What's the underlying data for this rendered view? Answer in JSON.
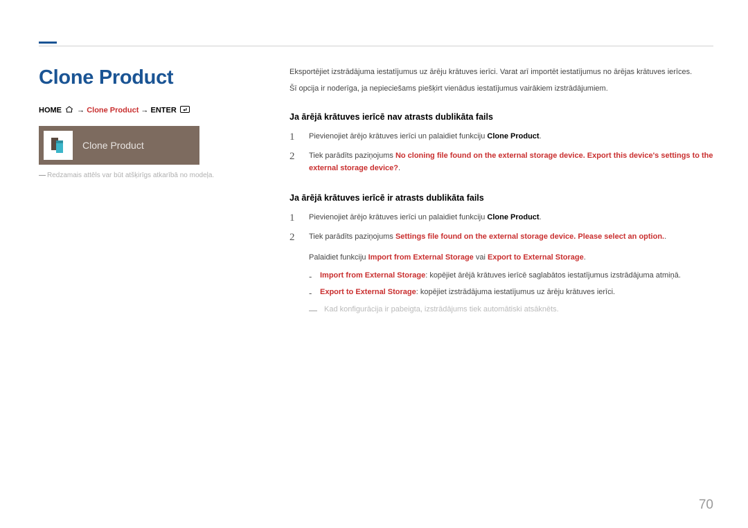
{
  "page": {
    "title": "Clone Product",
    "number": "70"
  },
  "breadcrumb": {
    "home": "HOME",
    "arrow": " → ",
    "item": "Clone Product",
    "enter": "ENTER"
  },
  "tile": {
    "label": "Clone Product"
  },
  "caption": {
    "text": "Redzamais attēls var būt atšķirīgs atkarībā no modeļa."
  },
  "intro": {
    "p1": "Eksportējiet izstrādājuma iestatījumus uz ārēju krātuves ierīci. Varat arī importēt iestatījumus no ārējas krātuves ierīces.",
    "p2": "Šī opcija ir noderīga, ja nepieciešams piešķirt vienādus iestatījumus vairākiem izstrādājumiem."
  },
  "section1": {
    "heading": "Ja ārējā krātuves ierīcē nav atrasts dublikāta fails",
    "step1_pre": "Pievienojiet ārējo krātuves ierīci un palaidiet funkciju ",
    "step1_hl": "Clone Product",
    "step1_post": ".",
    "step2_pre": "Tiek parādīts paziņojums ",
    "step2_hl": "No cloning file found on the external storage device. Export this device's settings to the external storage device?",
    "step2_post": "."
  },
  "section2": {
    "heading": "Ja ārējā krātuves ierīcē ir atrasts dublikāta fails",
    "step1_pre": "Pievienojiet ārējo krātuves ierīci un palaidiet funkciju ",
    "step1_hl": "Clone Product",
    "step1_post": ".",
    "step2_pre": "Tiek parādīts paziņojums ",
    "step2_hl": "Settings file found on the external storage device. Please select an option.",
    "step2_post": ".",
    "run_pre": "Palaidiet funkciju ",
    "run_hl1": "Import from External Storage",
    "run_mid": " vai ",
    "run_hl2": "Export to External Storage",
    "run_post": ".",
    "bullet1_hl": "Import from External Storage",
    "bullet1_txt": ": kopējiet ārējā krātuves ierīcē saglabātos iestatījumus izstrādājuma atmiņā.",
    "bullet2_hl": "Export to External Storage",
    "bullet2_txt": ": kopējiet izstrādājuma iestatījumus uz ārēju krātuves ierīci.",
    "footnote": "Kad konfigurācija ir pabeigta, izstrādājums tiek automātiski atsāknēts."
  },
  "nums": {
    "one": "1",
    "two": "2"
  }
}
